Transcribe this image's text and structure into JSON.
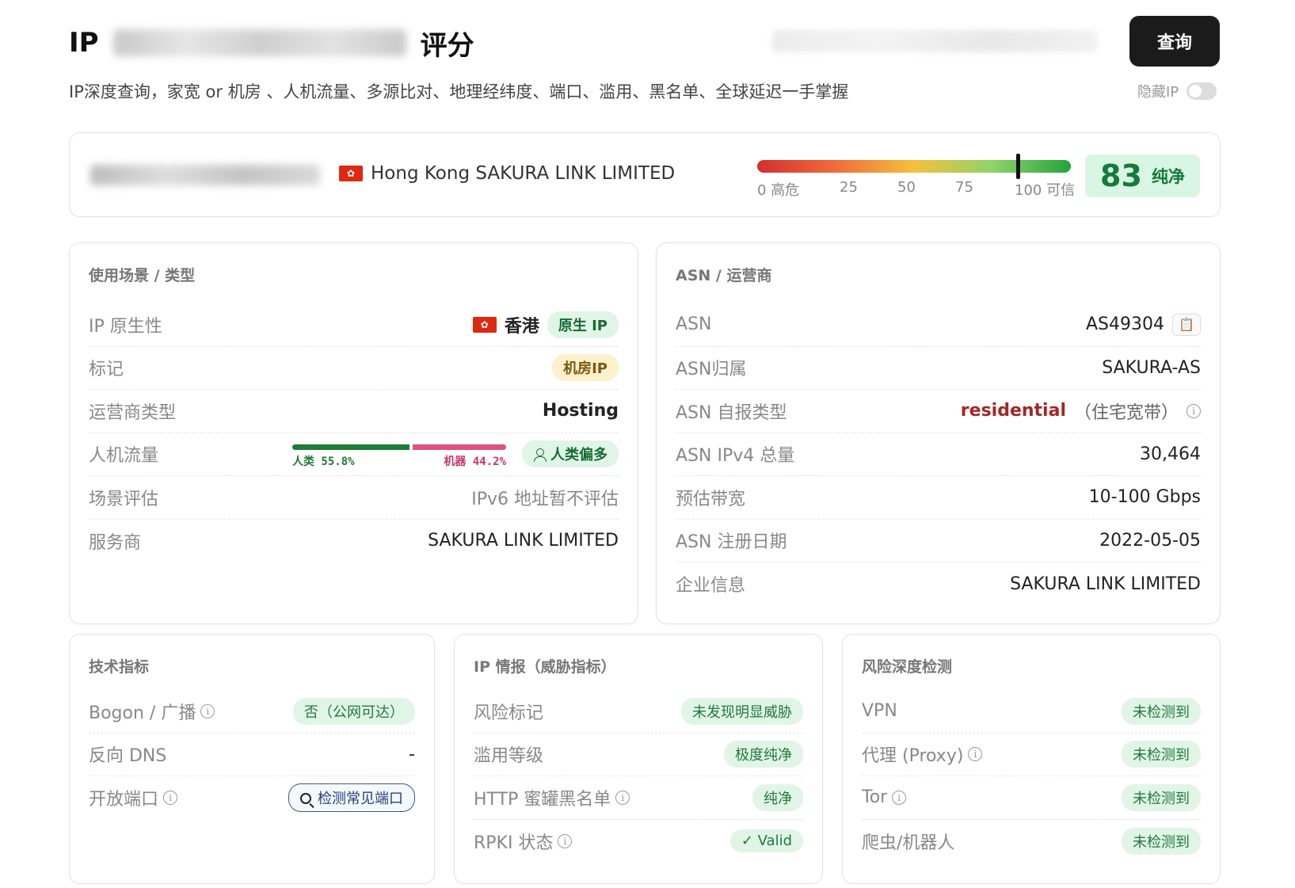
{
  "header": {
    "title_prefix": "IP",
    "title_suffix": "评分",
    "query_button": "查询",
    "subtitle": "IP深度查询，家宽 or 机房 、人机流量、多源比对、地理经纬度、端口、滥用、黑名单、全球延迟一手掌握",
    "hide_ip_label": "隐藏IP"
  },
  "summary": {
    "location": "Hong Kong SAKURA LINK LIMITED",
    "flag_glyph": "✿",
    "score": 83,
    "score_fraction": 0.83,
    "score_label": "纯净",
    "ticks": [
      "0 高危",
      "25",
      "50",
      "75",
      "100 可信"
    ]
  },
  "usage": {
    "title": "使用场景 / 类型",
    "native_label": "IP 原生性",
    "native_region": "香港",
    "native_badge": "原生 IP",
    "tag_label": "标记",
    "tag_value": "机房IP",
    "isp_type_label": "运营商类型",
    "isp_type_value": "Hosting",
    "traffic_label": "人机流量",
    "traffic_human_label": "人类 55.8%",
    "traffic_bot_label": "机器 44.2%",
    "traffic_human_fraction": 0.558,
    "traffic_badge": "人类偏多",
    "scene_label": "场景评估",
    "scene_value": "IPv6 地址暂不评估",
    "provider_label": "服务商",
    "provider_value": "SAKURA LINK LIMITED"
  },
  "asn": {
    "title": "ASN / 运营商",
    "asn_label": "ASN",
    "asn_value": "AS49304",
    "owner_label": "ASN归属",
    "owner_value": "SAKURA-AS",
    "self_type_label": "ASN 自报类型",
    "self_type_value": "residential",
    "self_type_note": "（住宅宽带）",
    "ipv4_label": "ASN IPv4 总量",
    "ipv4_value": "30,464",
    "bandwidth_label": "预估带宽",
    "bandwidth_value": "10-100 Gbps",
    "reg_date_label": "ASN 注册日期",
    "reg_date_value": "2022-05-05",
    "company_label": "企业信息",
    "company_value": "SAKURA LINK LIMITED"
  },
  "tech": {
    "title": "技术指标",
    "bogon_label": "Bogon / 广播",
    "bogon_value": "否（公网可达）",
    "rdns_label": "反向 DNS",
    "rdns_value": "-",
    "ports_label": "开放端口",
    "ports_button": "检测常见端口"
  },
  "intel": {
    "title": "IP 情报（威胁指标）",
    "risk_label": "风险标记",
    "risk_value": "未发现明显威胁",
    "abuse_label": "滥用等级",
    "abuse_value": "极度纯净",
    "honeypot_label": "HTTP 蜜罐黑名单",
    "honeypot_value": "纯净",
    "rpki_label": "RPKI 状态",
    "rpki_value": "✓ Valid"
  },
  "risk": {
    "title": "风险深度检测",
    "vpn_label": "VPN",
    "vpn_value": "未检测到",
    "proxy_label": "代理 (Proxy)",
    "proxy_value": "未检测到",
    "tor_label": "Tor",
    "tor_value": "未检测到",
    "crawler_label": "爬虫/机器人",
    "crawler_value": "未检测到"
  },
  "icons": {
    "info": "i",
    "copy": "📋"
  }
}
